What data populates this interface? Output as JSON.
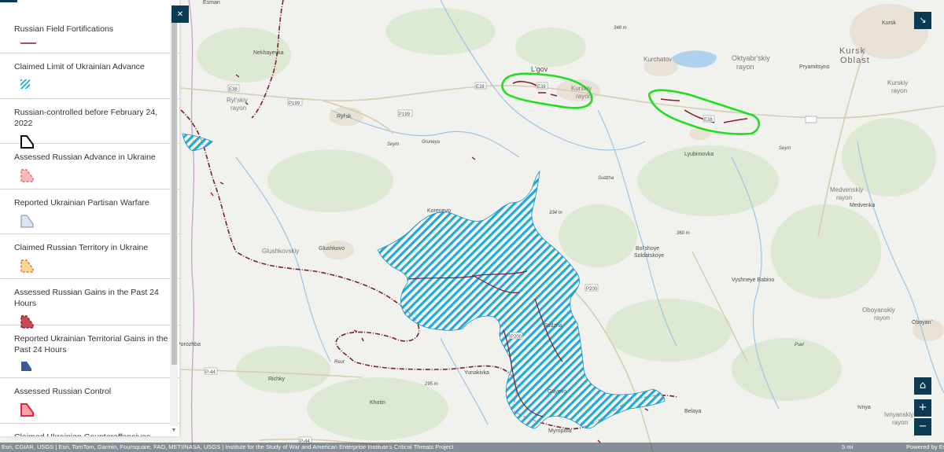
{
  "legend": {
    "items": [
      {
        "label": "Russian Field Fortifications",
        "kind": "line",
        "color": "#8b1a2b"
      },
      {
        "label": "Claimed Limit of Ukrainian Advance",
        "kind": "hatch",
        "color": "#23a9d6"
      },
      {
        "label": "Russian-controlled before February 24, 2022",
        "kind": "outline",
        "color": "#111111"
      },
      {
        "label": "Assessed Russian Advance in Ukraine",
        "kind": "dashfill",
        "color": "#e8646e"
      },
      {
        "label": "Reported Ukrainian Partisan Warfare",
        "kind": "lightfill",
        "color": "#c8d6ea"
      },
      {
        "label": "Claimed Russian Territory in Ukraine",
        "kind": "dashfill",
        "color": "#f2b84b"
      },
      {
        "label": "Assessed Russian Gains in the Past 24 Hours",
        "kind": "dashfill",
        "color": "#b8323f"
      },
      {
        "label": "Reported Ukrainian Territorial Gains in the Past 24 Hours",
        "kind": "solidfill",
        "color": "#3c5a9a"
      },
      {
        "label": "Assessed Russian Control",
        "kind": "redfill",
        "color": "#e8283a"
      },
      {
        "label": "Claimed Ukrainian Counteroffensives",
        "kind": "none",
        "color": "#3366cc"
      }
    ]
  },
  "map_labels": {
    "places": [
      "Esman",
      "Nekhayevka",
      "Ryl'sk",
      "L'gov",
      "Kurchatov",
      "Oktyabr'skiy",
      "rayon",
      "Kursk",
      "Kursk",
      "Oblast",
      "Kurskiy",
      "rayon",
      "Pryamitsyno",
      "Lyubimovka",
      "Medvenskiy",
      "rayon",
      "Medvenka",
      "Korenevo",
      "Glushkovo",
      "Glushkovskiy",
      "Bol'shoye",
      "Soldatskoye",
      "Vyshneye Babino",
      "Sudzha",
      "Oboyanskiy",
      "rayon",
      "Oboyan'",
      "Porozhba",
      "Richky",
      "Yunakivka",
      "Khotin",
      "Guyevo",
      "Belaya",
      "Ivnya",
      "Myropillia",
      "Ivnyanskiy",
      "rayon",
      "Kurskiy",
      "rayon",
      "Ryl'skiy",
      "rayon"
    ],
    "roads": [
      "E38",
      "P199",
      "P199",
      "E38",
      "E38",
      "E38",
      "P200",
      "P200",
      "P-44",
      "P-44"
    ],
    "rivers": [
      "Seym",
      "Seym",
      "Psel",
      "Sudzha",
      "Gruneya",
      "Reut"
    ],
    "elevations": [
      "348 m",
      "334 m",
      "360 m",
      "295 m"
    ]
  },
  "controls": {
    "close": "✕",
    "collapse": "↘",
    "home": "⌂",
    "zoom_in": "+",
    "zoom_out": "−"
  },
  "attribution": {
    "text": "Esri, CGIAR, USGS | Esri, TomTom, Garmin, Foursquare, FAO, METI/NASA, USGS | Institute for the Study of War and American Enterprise Institute's Critical Threats Project",
    "scale": "5 mi",
    "powered": "Powered by Esri"
  },
  "colors": {
    "hatch": "#23a9d6",
    "fortification": "#8b1a2b",
    "highlight": "#22dd22",
    "control_bg": "#0b3a55",
    "background": "#f1f1ee"
  }
}
